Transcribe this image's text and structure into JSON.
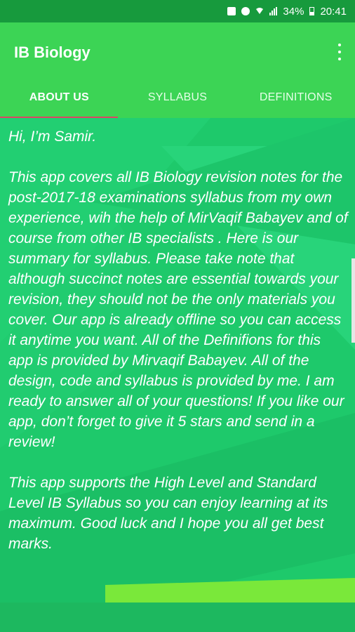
{
  "status_bar": {
    "battery": "34%",
    "time": "20:41",
    "icons": [
      "notification-icon",
      "sync-icon",
      "wifi-icon",
      "signal-icon",
      "battery-icon"
    ]
  },
  "app": {
    "title": "IB Biology",
    "menu_icon": "more-vert-icon"
  },
  "tabs": [
    {
      "label": "ABOUT US",
      "active": true
    },
    {
      "label": "SYLLABUS",
      "active": false
    },
    {
      "label": "DEFINITIONS",
      "active": false
    }
  ],
  "about": {
    "greeting": "Hi, I’m Samir.",
    "paragraph1": "This app covers all IB Biology revision notes for the post-2017-18 examinations syllabus from my own experience, wih the help of MirVaqif Babayev and of course from other IB specialists . Here is our summary for syllabus. Please take note that although succinct notes are essential towards your revision, they should not be the only materials you cover. Our app is already offline so you can access it anytime you want. All of the Definifions for this app is provided by Mirvaqif Babayev. All of the design, code and syllabus is provided by me. I am ready to answer all of your questions! If you like our app, don’t forget to give it 5 stars and send in a review!",
    "paragraph2": "This app supports the High Level and Standard Level IB Syllabus so you can enjoy learning at its maximum. Good luck and I hope you all get best marks."
  },
  "colors": {
    "status_bar": "#179a3d",
    "app_bar": "#3cd455",
    "content_bg": "#1ec96b",
    "tab_indicator": "#e04462",
    "text": "#ffffff"
  }
}
